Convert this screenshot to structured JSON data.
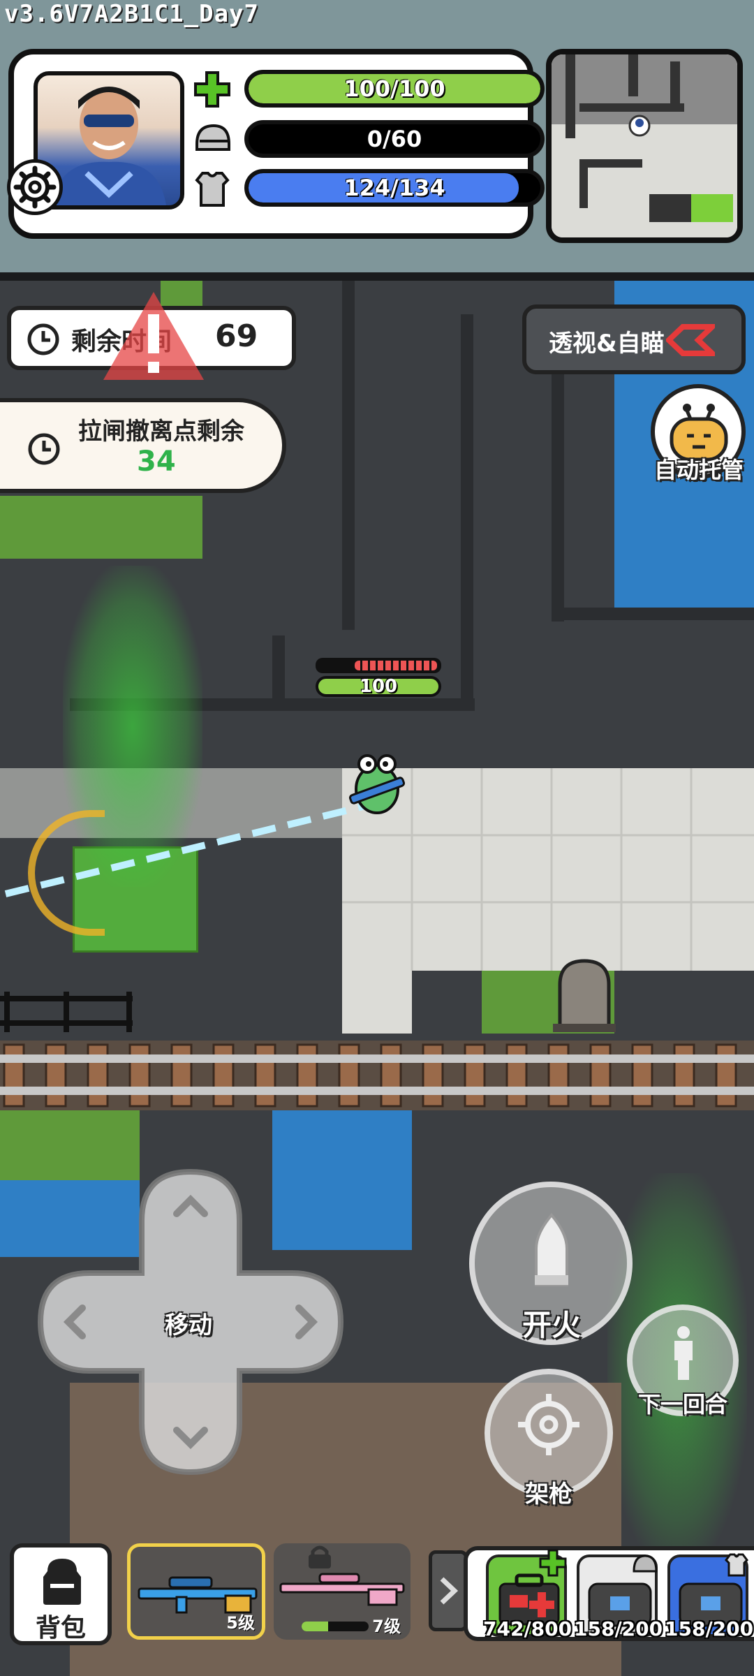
{
  "version": "v3.6V7A2B1C1_Day7",
  "status": {
    "health": {
      "text": "100/100",
      "fraction": 1.0,
      "color": "#8fcf4a",
      "icon": "green-cross-icon"
    },
    "helmet": {
      "text": "0/60",
      "fraction": 0.0,
      "color": "#5a5a5a",
      "icon": "helmet-icon"
    },
    "armor": {
      "text": "124/134",
      "fraction": 0.925,
      "color": "#4a7df0",
      "icon": "armor-vest-icon"
    }
  },
  "timer": {
    "label": "剩余时间",
    "value": "69"
  },
  "extraction": {
    "label": "拉闸撤离点剩余",
    "value": "34",
    "value_color": "#2fb24a"
  },
  "cheat_button": {
    "label": "透视&自瞄"
  },
  "auto_button": {
    "label": "自动托管"
  },
  "enemy": {
    "health_text": "100"
  },
  "controls": {
    "move_label": "移动",
    "fire_label": "开火",
    "aim_label": "架枪",
    "next_round_label": "下一回合"
  },
  "inventory": {
    "backpack_label": "背包",
    "weapon1_level": "5级",
    "weapon2_level": "7级",
    "supplies": [
      {
        "count": "742/800",
        "icon": "medkit-icon"
      },
      {
        "count": "158/200",
        "icon": "helmet-bag-icon"
      },
      {
        "count": "158/200",
        "icon": "armor-bag-icon"
      }
    ]
  }
}
